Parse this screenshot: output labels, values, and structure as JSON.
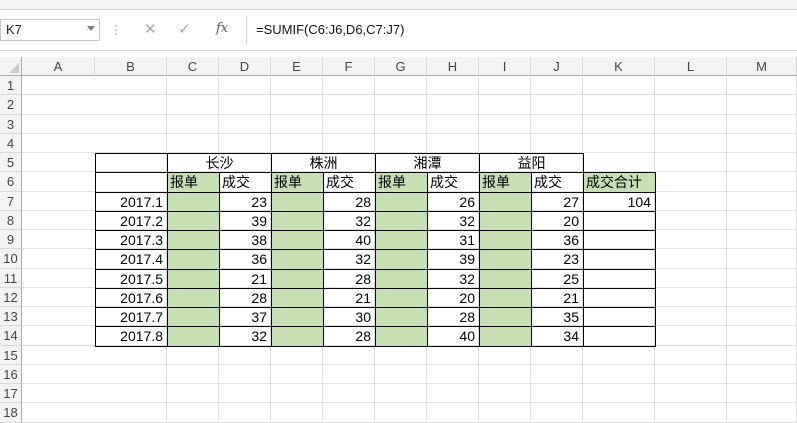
{
  "formula_bar": {
    "cell_ref": "K7",
    "cancel_icon": "✕",
    "enter_icon": "✓",
    "fx_label": "fx",
    "formula": "=SUMIF(C6:J6,D6,C7:J7)"
  },
  "columns": [
    "A",
    "B",
    "C",
    "D",
    "E",
    "F",
    "G",
    "H",
    "I",
    "J",
    "K",
    "L",
    "M"
  ],
  "rows": [
    "1",
    "2",
    "3",
    "4",
    "5",
    "6",
    "7",
    "8",
    "9",
    "10",
    "11",
    "12",
    "13",
    "14",
    "15",
    "16",
    "17",
    "18"
  ],
  "table": {
    "groups": [
      "长沙",
      "株洲",
      "湘潭",
      "益阳"
    ],
    "sub_headers": [
      "报单",
      "成交",
      "报单",
      "成交",
      "报单",
      "成交",
      "报单",
      "成交"
    ],
    "total_header": "成交合计",
    "periods": [
      "2017.1",
      "2017.2",
      "2017.3",
      "2017.4",
      "2017.5",
      "2017.6",
      "2017.7",
      "2017.8"
    ],
    "deals": [
      [
        "23",
        "28",
        "26",
        "27"
      ],
      [
        "39",
        "32",
        "32",
        "20"
      ],
      [
        "38",
        "40",
        "31",
        "36"
      ],
      [
        "36",
        "32",
        "39",
        "23"
      ],
      [
        "21",
        "28",
        "32",
        "25"
      ],
      [
        "28",
        "21",
        "20",
        "21"
      ],
      [
        "37",
        "30",
        "28",
        "35"
      ],
      [
        "32",
        "28",
        "40",
        "34"
      ]
    ],
    "total_values": [
      "104"
    ]
  },
  "colors": {
    "green_fill": "#c6e0b4",
    "header_bg": "#f3f3f3",
    "gridline": "#e1e1e1"
  }
}
